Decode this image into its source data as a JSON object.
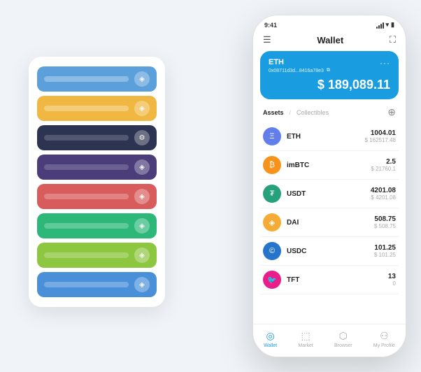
{
  "phone": {
    "status": {
      "time": "9:41",
      "wifi": "WiFi",
      "battery": "Battery"
    },
    "header": {
      "menu_icon": "☰",
      "title": "Wallet",
      "expand_icon": "⛶"
    },
    "eth_card": {
      "currency": "ETH",
      "address": "0x08711d3d...8416a78e3",
      "copy_icon": "⧉",
      "dots": "···",
      "currency_symbol": "$",
      "balance": "189,089.11"
    },
    "assets_section": {
      "tab_active": "Assets",
      "tab_divider": "/",
      "tab_inactive": "Collectibles",
      "add_icon": "⊕"
    },
    "assets": [
      {
        "name": "ETH",
        "icon": "Ξ",
        "icon_class": "icon-eth",
        "amount": "1004.01",
        "usd": "$ 162517.48"
      },
      {
        "name": "imBTC",
        "icon": "₿",
        "icon_class": "icon-imbtc",
        "amount": "2.5",
        "usd": "$ 21760.1"
      },
      {
        "name": "USDT",
        "icon": "₮",
        "icon_class": "icon-usdt",
        "amount": "4201.08",
        "usd": "$ 4201.08"
      },
      {
        "name": "DAI",
        "icon": "◈",
        "icon_class": "icon-dai",
        "amount": "508.75",
        "usd": "$ 508.75"
      },
      {
        "name": "USDC",
        "icon": "©",
        "icon_class": "icon-usdc",
        "amount": "101.25",
        "usd": "$ 101.25"
      },
      {
        "name": "TFT",
        "icon": "🐦",
        "icon_class": "icon-tft",
        "amount": "13",
        "usd": "0"
      }
    ],
    "nav": [
      {
        "label": "Wallet",
        "active": true
      },
      {
        "label": "Market",
        "active": false
      },
      {
        "label": "Browser",
        "active": false
      },
      {
        "label": "My Profile",
        "active": false
      }
    ]
  },
  "card_stack": {
    "cards": [
      {
        "color": "#5b9fdb",
        "label_color": "rgba(255,255,255,0.5)",
        "icon": "◈"
      },
      {
        "color": "#f0b842",
        "label_color": "rgba(255,255,255,0.5)",
        "icon": "◈"
      },
      {
        "color": "#2d3452",
        "label_color": "rgba(255,255,255,0.3)",
        "icon": "⚙"
      },
      {
        "color": "#4a3d7a",
        "label_color": "rgba(255,255,255,0.3)",
        "icon": "◈"
      },
      {
        "color": "#d85c5c",
        "label_color": "rgba(255,255,255,0.4)",
        "icon": "◈"
      },
      {
        "color": "#2db87a",
        "label_color": "rgba(255,255,255,0.4)",
        "icon": "◈"
      },
      {
        "color": "#8dc63f",
        "label_color": "rgba(255,255,255,0.4)",
        "icon": "◈"
      },
      {
        "color": "#4a90d9",
        "label_color": "rgba(255,255,255,0.4)",
        "icon": "◈"
      }
    ]
  }
}
